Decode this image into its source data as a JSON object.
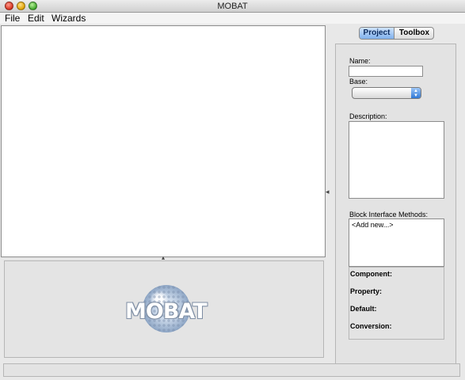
{
  "window": {
    "title": "MOBAT",
    "controls": [
      "close-icon",
      "minimize-icon",
      "zoom-icon"
    ]
  },
  "menu": {
    "items": [
      "File",
      "Edit",
      "Wizards"
    ]
  },
  "logo": {
    "text": "MOBAT"
  },
  "right_panel": {
    "tabs": [
      {
        "label": "Project",
        "active": true
      },
      {
        "label": "Toolbox",
        "active": false
      }
    ],
    "name_label": "Name:",
    "name_value": "",
    "base_label": "Base:",
    "base_value": "",
    "description_label": "Description:",
    "description_value": "",
    "methods_label": "Block Interface Methods:",
    "methods_items": [
      "<Add new...>"
    ],
    "details": [
      "Component:",
      "Property:",
      "Default:",
      "Conversion:"
    ]
  },
  "status": {
    "text": ""
  },
  "colors": {
    "active_tab": "#7fb0ec",
    "select_arrow": "#2f78d6",
    "window_bg": "#e8e8e8"
  }
}
